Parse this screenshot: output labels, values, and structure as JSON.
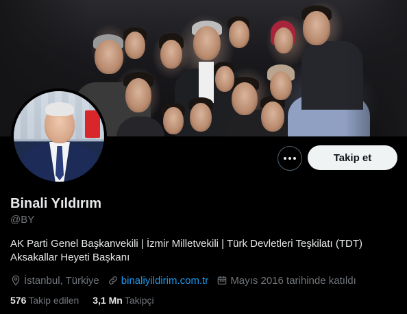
{
  "profile": {
    "display_name": "Binali Yıldırım",
    "handle": "@BY",
    "bio": "AK Parti Genel Başkanvekili | İzmir Milletvekili | Türk Devletleri Teşkilatı (TDT) Aksakallar Heyeti Başkanı",
    "location": "İstanbul, Türkiye",
    "website": "binaliyildirim.com.tr",
    "joined": "Mayıs 2016 tarihinde katıldı"
  },
  "actions": {
    "more_icon": "ellipsis-icon",
    "follow_label": "Takip et"
  },
  "stats": {
    "following_count": "576",
    "following_label": "Takip edilen",
    "followers_count": "3,1 Mn",
    "followers_label": "Takipçi"
  },
  "icons": {
    "location": "location-pin-icon",
    "website": "link-icon",
    "joined": "calendar-icon"
  },
  "colors": {
    "background": "#000000",
    "text_primary": "#e7e9ea",
    "text_secondary": "#71767b",
    "link": "#1d9bf0",
    "follow_button_bg": "#eff3f4"
  }
}
